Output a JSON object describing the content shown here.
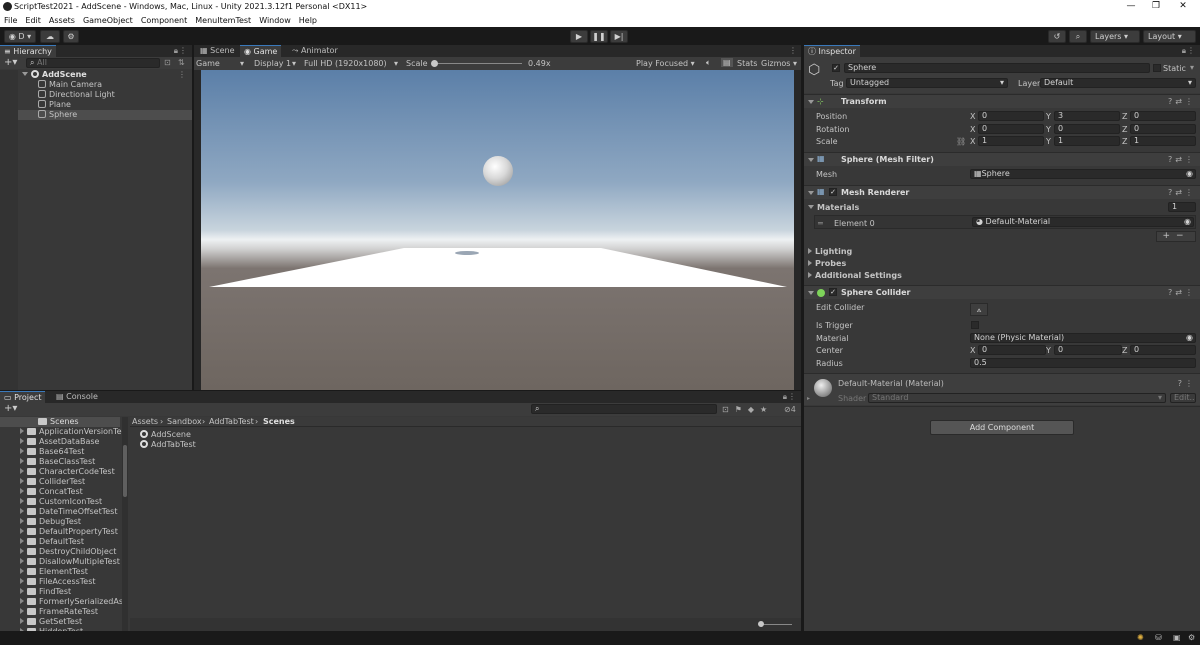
{
  "window": {
    "title": "ScriptTest2021 - AddScene - Windows, Mac, Linux - Unity 2021.3.12f1 Personal <DX11>"
  },
  "menu": [
    "File",
    "Edit",
    "Assets",
    "GameObject",
    "Component",
    "MenuItemTest",
    "Window",
    "Help"
  ],
  "toolbar": {
    "account": "D",
    "layers": "Layers",
    "layout": "Layout"
  },
  "hierarchy": {
    "tab": "Hierarchy",
    "search_placeholder": "All",
    "scene": "AddScene",
    "items": [
      "Main Camera",
      "Directional Light",
      "Plane",
      "Sphere"
    ],
    "selected_index": 3
  },
  "scene_view": {
    "tabs": [
      "Scene",
      "Game",
      "Animator"
    ],
    "active_tab": 1,
    "mode": "Game",
    "display": "Display 1",
    "resolution": "Full HD (1920x1080)",
    "scale_label": "Scale",
    "scale_value": "0.49x",
    "play_focused": "Play Focused",
    "stats": "Stats",
    "gizmos": "Gizmos"
  },
  "inspector": {
    "tab": "Inspector",
    "object_name": "Sphere",
    "static_label": "Static",
    "tag_label": "Tag",
    "tag_value": "Untagged",
    "layer_label": "Layer",
    "layer_value": "Default",
    "transform": {
      "title": "Transform",
      "rows": [
        {
          "label": "Position",
          "x": "0",
          "y": "3",
          "z": "0"
        },
        {
          "label": "Rotation",
          "x": "0",
          "y": "0",
          "z": "0"
        },
        {
          "label": "Scale",
          "x": "1",
          "y": "1",
          "z": "1"
        }
      ]
    },
    "mesh_filter": {
      "title": "Sphere (Mesh Filter)",
      "mesh_label": "Mesh",
      "mesh_value": "Sphere"
    },
    "mesh_renderer": {
      "title": "Mesh Renderer",
      "materials_label": "Materials",
      "materials_count": "1",
      "element_label": "Element 0",
      "element_value": "Default-Material",
      "sections": [
        "Lighting",
        "Probes",
        "Additional Settings"
      ]
    },
    "sphere_collider": {
      "title": "Sphere Collider",
      "edit_collider": "Edit Collider",
      "is_trigger": "Is Trigger",
      "material_label": "Material",
      "material_value": "None (Physic Material)",
      "center_label": "Center",
      "center": {
        "x": "0",
        "y": "0",
        "z": "0"
      },
      "radius_label": "Radius",
      "radius_value": "0.5"
    },
    "material": {
      "title": "Default-Material (Material)",
      "shader_label": "Shader",
      "shader_value": "Standard",
      "edit": "Edit..."
    },
    "add_component": "Add Component",
    "axis_x": "X",
    "axis_y": "Y",
    "axis_z": "Z"
  },
  "project": {
    "tabs": [
      "Project",
      "Console"
    ],
    "folders_header": "Scenes",
    "folders": [
      "ApplicationVersionTest",
      "AssetDataBase",
      "Base64Test",
      "BaseClassTest",
      "CharacterCodeTest",
      "ColliderTest",
      "ConcatTest",
      "CustomIconTest",
      "DateTimeOffsetTest",
      "DebugTest",
      "DefaultPropertyTest",
      "DefaultTest",
      "DestroyChildObject",
      "DisallowMultipleTest",
      "ElementTest",
      "FileAccessTest",
      "FindTest",
      "FormerlySerializedAsTe",
      "FrameRateTest",
      "GetSetTest",
      "HiddenTest"
    ],
    "breadcrumb": [
      "Assets",
      "Sandbox",
      "AddTabTest",
      "Scenes"
    ],
    "assets": [
      "AddScene",
      "AddTabTest"
    ],
    "hidden_count": "4"
  },
  "colors": {
    "accent": "#3a79bb",
    "selection": "#4d4d4d",
    "panel": "#383838"
  }
}
